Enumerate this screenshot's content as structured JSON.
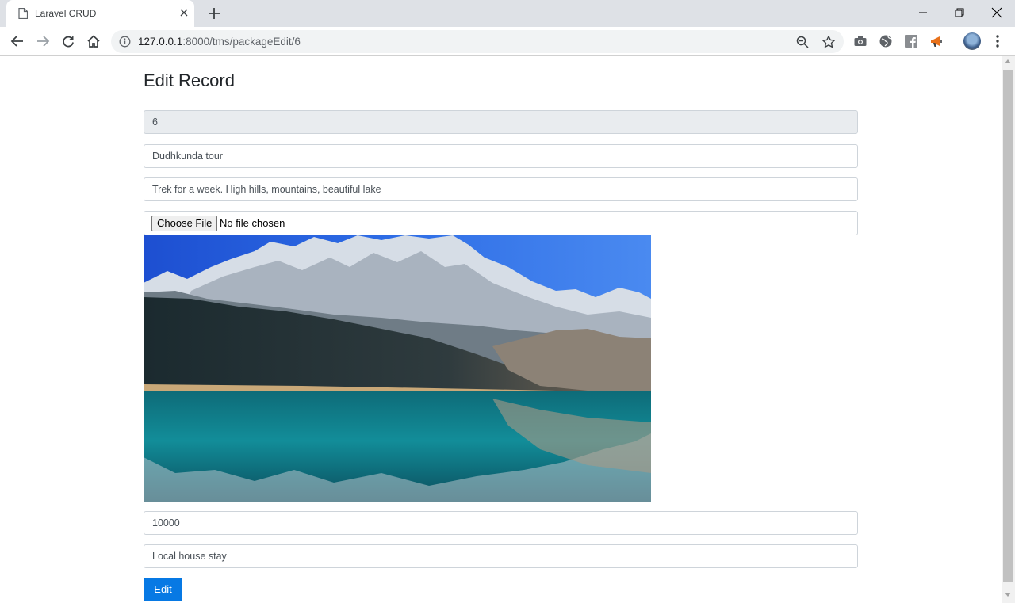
{
  "browser": {
    "tab_title": "Laravel CRUD",
    "url_host": "127.0.0.1",
    "url_path": ":8000/tms/packageEdit/6"
  },
  "page": {
    "heading": "Edit Record",
    "fields": {
      "id": "6",
      "name": "Dudhkunda tour",
      "description": "Trek for a week. High hills, mountains, beautiful lake",
      "file_button": "Choose File",
      "file_status": "No file chosen",
      "price": "10000",
      "accommodation": "Local house stay"
    },
    "submit_label": "Edit"
  },
  "colors": {
    "primary": "#0779e4",
    "tabstrip": "#dee1e6",
    "readonly_bg": "#e9ecef"
  }
}
